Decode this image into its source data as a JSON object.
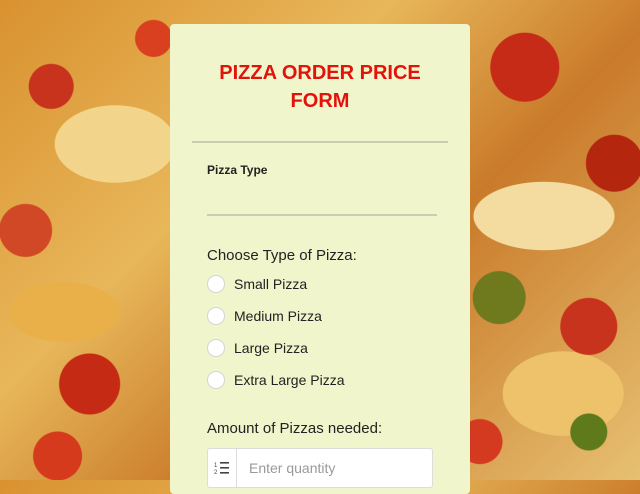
{
  "form": {
    "title": "PIZZA ORDER PRICE FORM",
    "pizza_type_label": "Pizza Type",
    "pizza_type_value": "",
    "choose_label": "Choose Type of Pizza:",
    "options": [
      {
        "label": "Small Pizza"
      },
      {
        "label": "Medium Pizza"
      },
      {
        "label": "Large Pizza"
      },
      {
        "label": "Extra Large Pizza"
      }
    ],
    "amount_label": "Amount of Pizzas needed:",
    "quantity": {
      "icon": "numbered-list-icon",
      "placeholder": "Enter quantity",
      "value": ""
    }
  },
  "colors": {
    "title": "#e3120b",
    "card_background": "#f0f5cc"
  }
}
